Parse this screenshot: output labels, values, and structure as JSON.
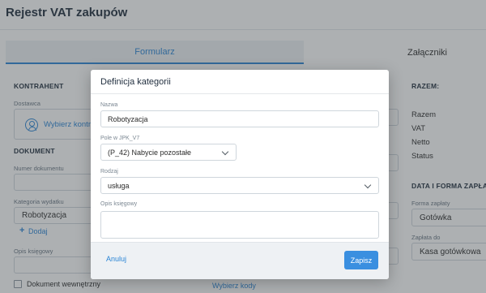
{
  "page": {
    "title": "Rejestr VAT zakupów",
    "tabs": [
      {
        "label": "Formularz"
      },
      {
        "label": "Załączniki"
      }
    ]
  },
  "left": {
    "contractor_heading": "KONTRAHENT",
    "supplier_label": "Dostawca",
    "choose_contractor": "Wybierz kontra",
    "document_heading": "DOKUMENT",
    "doc_number_label": "Numer dokumentu",
    "expense_category_label": "Kategoria wydatku",
    "expense_category_value": "Robotyzacja",
    "add_link": "Dodaj",
    "add_icon": "plus-icon",
    "description_label": "Opis księgowy",
    "internal_doc_label": "Dokument wewnętrzny",
    "choose_codes": "Wybierz kody"
  },
  "right": {
    "summary_heading": "RAZEM:",
    "summary_items": [
      "Razem",
      "VAT",
      "Netto",
      "Status"
    ],
    "payment_heading": "DATA I FORMA ZAPŁATY",
    "payment_form_label": "Forma zapłaty",
    "payment_form_value": "Gotówka",
    "payment_to_label": "Zapłata do",
    "payment_to_value": "Kasa gotówkowa"
  },
  "modal": {
    "title": "Definicja kategorii",
    "name_label": "Nazwa",
    "name_value": "Robotyzacja",
    "jpk_label": "Pole w JPK_V7",
    "jpk_value": "(P_42) Nabycie pozostałe",
    "type_label": "Rodzaj",
    "type_value": "usługa",
    "desc_label": "Opis księgowy",
    "desc_value": "",
    "cancel_label": "Anuluj",
    "save_label": "Zapisz"
  },
  "colors": {
    "accent": "#2c86d6",
    "save_button": "#3a8fe0",
    "overlay": "rgba(60,66,72,0.42)"
  }
}
